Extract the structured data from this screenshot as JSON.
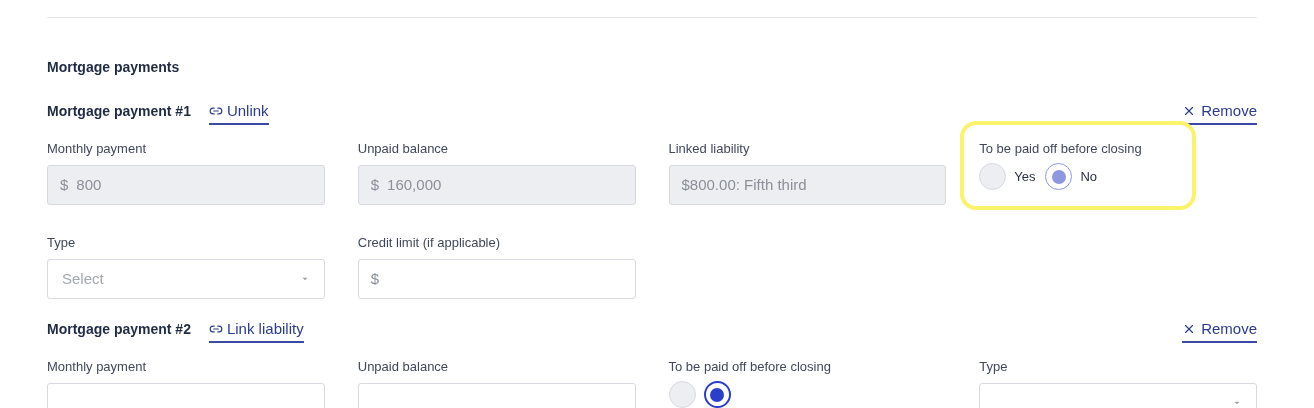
{
  "section": {
    "title": "Mortgage payments"
  },
  "payments": [
    {
      "title": "Mortgage payment #1",
      "link": "Unlink",
      "remove": "Remove",
      "disabled": true,
      "fields": [
        {
          "kind": "money",
          "label": "Monthly payment",
          "prefix": "$",
          "value": "800"
        },
        {
          "kind": "money",
          "label": "Unpaid balance",
          "prefix": "$",
          "value": "160,000"
        },
        {
          "kind": "text",
          "label": "Linked liability",
          "value": "$800.00: Fifth third"
        },
        {
          "kind": "radio",
          "label": "To be paid off before closing",
          "highlighted": true,
          "options": [
            {
              "label": "Yes",
              "selected": false
            },
            {
              "label": "No",
              "selected": true
            }
          ]
        },
        {
          "kind": "select",
          "label": "Type",
          "placeholder": "Select",
          "editable": true
        },
        {
          "kind": "money",
          "label": "Credit limit (if applicable)",
          "prefix": "$",
          "editable": true
        }
      ]
    },
    {
      "title": "Mortgage payment #2",
      "link": "Link liability",
      "remove": "Remove",
      "disabled": false,
      "fields": [
        {
          "kind": "money",
          "label": "Monthly payment"
        },
        {
          "kind": "money",
          "label": "Unpaid balance"
        },
        {
          "kind": "radio",
          "label": "To be paid off before closing",
          "highlighted": false,
          "options": [
            {
              "selected": false
            },
            {
              "selected": true
            }
          ]
        },
        {
          "kind": "select",
          "label": "Type"
        }
      ]
    }
  ]
}
